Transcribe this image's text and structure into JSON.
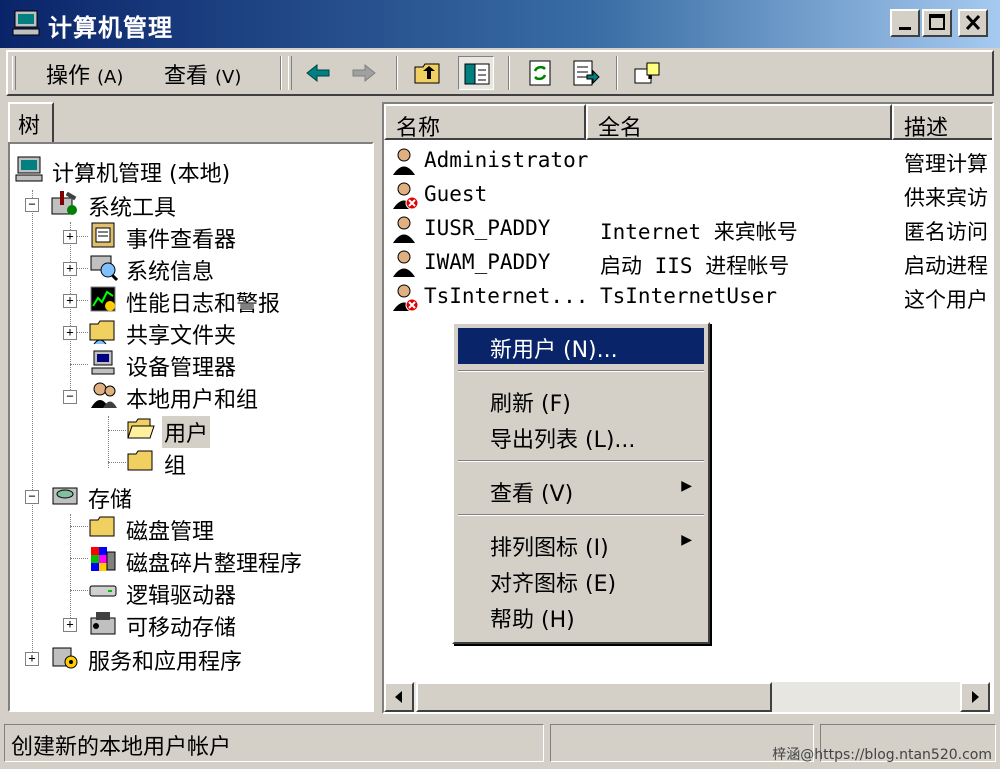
{
  "window": {
    "title": "计算机管理",
    "buttons": [
      "minimize-button",
      "maximize-button",
      "close-button"
    ]
  },
  "toolbar": {
    "menus": [
      {
        "label": "操作",
        "accel": "(A)"
      },
      {
        "label": "查看",
        "accel": "(V)"
      }
    ],
    "icons": [
      "back-arrow-icon",
      "forward-arrow-icon",
      "up-folder-icon",
      "show-tree-icon",
      "refresh-icon",
      "export-list-icon",
      "help-icon"
    ]
  },
  "left_pane": {
    "tab_label": "树",
    "tree": [
      {
        "label": "计算机管理 (本地)",
        "icon": "computer-icon"
      },
      {
        "label": "系统工具",
        "icon": "system-tools-icon"
      },
      {
        "label": "事件查看器",
        "icon": "event-viewer-icon"
      },
      {
        "label": "系统信息",
        "icon": "system-info-icon"
      },
      {
        "label": "性能日志和警报",
        "icon": "performance-icon"
      },
      {
        "label": "共享文件夹",
        "icon": "shared-folder-icon"
      },
      {
        "label": "设备管理器",
        "icon": "device-manager-icon"
      },
      {
        "label": "本地用户和组",
        "icon": "users-groups-icon"
      },
      {
        "label": "用户",
        "icon": "open-folder-icon"
      },
      {
        "label": "组",
        "icon": "folder-icon"
      },
      {
        "label": "存储",
        "icon": "storage-icon"
      },
      {
        "label": "磁盘管理",
        "icon": "folder-icon"
      },
      {
        "label": "磁盘碎片整理程序",
        "icon": "defrag-icon"
      },
      {
        "label": "逻辑驱动器",
        "icon": "drive-icon"
      },
      {
        "label": "可移动存储",
        "icon": "removable-storage-icon"
      },
      {
        "label": "服务和应用程序",
        "icon": "services-icon"
      }
    ]
  },
  "list": {
    "columns": [
      "名称",
      "全名",
      "描述"
    ],
    "rows": [
      {
        "name": "Administrator",
        "full_name": "",
        "description": "管理计算",
        "disabled": false
      },
      {
        "name": "Guest",
        "full_name": "",
        "description": "供来宾访",
        "disabled": true
      },
      {
        "name": "IUSR_PADDY",
        "full_name": "Internet 来宾帐号",
        "description": "匿名访问",
        "disabled": false
      },
      {
        "name": "IWAM_PADDY",
        "full_name": "启动 IIS 进程帐号",
        "description": "启动进程",
        "disabled": false
      },
      {
        "name": "TsInternet...",
        "full_name": "TsInternetUser",
        "description": "这个用户",
        "disabled": true
      }
    ]
  },
  "context_menu": {
    "items": [
      {
        "label": "新用户 (N)...",
        "highlighted": true
      },
      {
        "label": "刷新 (F)"
      },
      {
        "label": "导出列表 (L)..."
      },
      {
        "label": "查看 (V)",
        "submenu": true
      },
      {
        "label": "排列图标 (I)",
        "submenu": true
      },
      {
        "label": "对齐图标 (E)"
      },
      {
        "label": "帮助 (H)"
      }
    ]
  },
  "status_bar": {
    "text": "创建新的本地用户帐户",
    "watermark": "梓涵@https://blog.ntan520.com"
  },
  "colors": {
    "title_start": "#0a246a",
    "title_end": "#a6caf0",
    "highlight": "#0a246a",
    "face": "#d4d0c8"
  }
}
